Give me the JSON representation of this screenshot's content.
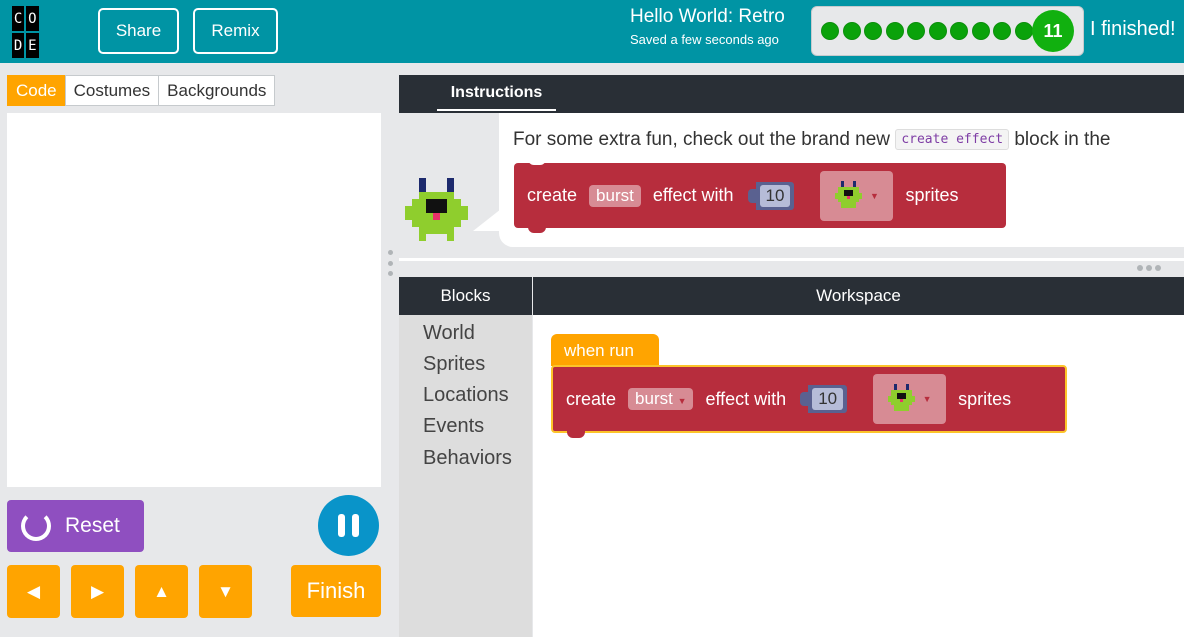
{
  "header": {
    "logo_letters": [
      "C",
      "O",
      "D",
      "E"
    ],
    "share_label": "Share",
    "remix_label": "Remix",
    "project_title": "Hello World: Retro",
    "saved_status": "Saved a few seconds ago",
    "current_level": "11",
    "completed_levels": 10,
    "finished_label": "I finished!"
  },
  "left_panel": {
    "tabs": [
      "Code",
      "Costumes",
      "Backgrounds"
    ],
    "active_tab": "Code",
    "reset_label": "Reset",
    "finish_label": "Finish",
    "arrow_icons": [
      "left-arrow-icon",
      "right-arrow-icon",
      "up-arrow-icon",
      "down-arrow-icon"
    ]
  },
  "instructions": {
    "tab_label": "Instructions",
    "text_before": "For some extra fun, check out the brand new ",
    "code_chip": "create effect",
    "text_after": " block in the",
    "example_block": {
      "create": "create",
      "effect_name": "burst",
      "with_label": "effect with",
      "count": "10",
      "sprites_label": "sprites"
    }
  },
  "blocks_panel": {
    "header": "Blocks",
    "categories": [
      "World",
      "Sprites",
      "Locations",
      "Events",
      "Behaviors"
    ]
  },
  "workspace": {
    "header": "Workspace",
    "hat_block_label": "when run",
    "block": {
      "create": "create",
      "effect_name": "burst",
      "with_label": "effect with",
      "count": "10",
      "sprites_label": "sprites"
    }
  },
  "colors": {
    "header_teal": "#0094a4",
    "orange": "#ffa400",
    "block_red": "#b72d3d",
    "progress_green": "#0aa20a",
    "reset_purple": "#8f4fc0",
    "pause_blue": "#0994c9",
    "dark_header": "#292f36"
  }
}
